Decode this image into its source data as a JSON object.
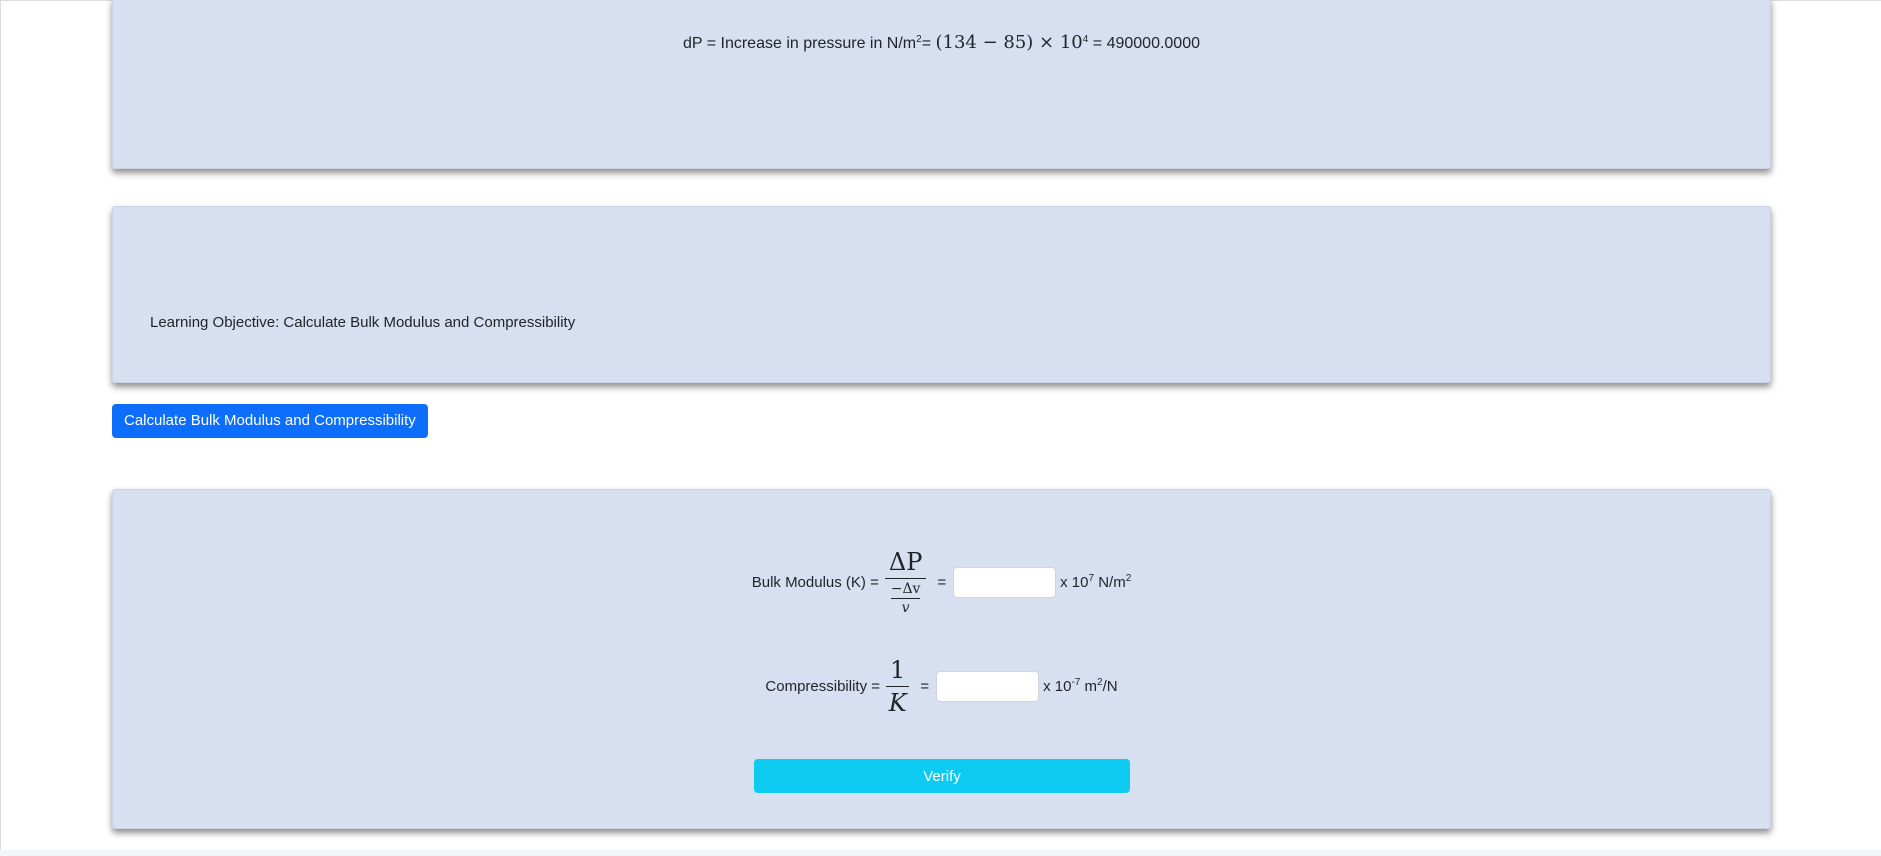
{
  "dp_card": {
    "label": "dP = Increase in pressure in N/m",
    "label_sup": "2",
    "eq_sign": "=",
    "expression": "(134 − 85) × 10",
    "expression_sup": "4",
    "result": "= 490000.0000"
  },
  "objective_card": {
    "text": "Learning Objective: Calculate Bulk Modulus and Compressibility"
  },
  "calculate_button": {
    "label": "Calculate Bulk Modulus and Compressibility"
  },
  "calc_card": {
    "bulk": {
      "label": "Bulk Modulus (K) =",
      "numerator": "ΔP",
      "inner_numerator": "−Δv",
      "inner_denominator": "v",
      "equals": "=",
      "input_value": "",
      "unit_prefix": "x 10",
      "unit_exp": "7",
      "unit_mid": " N/m",
      "unit_exp2": "2"
    },
    "compressibility": {
      "label": "Compressibility =",
      "numerator": "1",
      "denominator": "K",
      "equals": "=",
      "input_value": "",
      "unit_prefix": "x 10",
      "unit_exp": "-7",
      "unit_mid": " m",
      "unit_exp2": "2",
      "unit_suffix": "/N"
    },
    "verify_button": {
      "label": "Verify"
    }
  },
  "colors": {
    "card_bg": "#d6e0f1",
    "primary": "#0d6efd",
    "info": "#0dcaf0"
  }
}
